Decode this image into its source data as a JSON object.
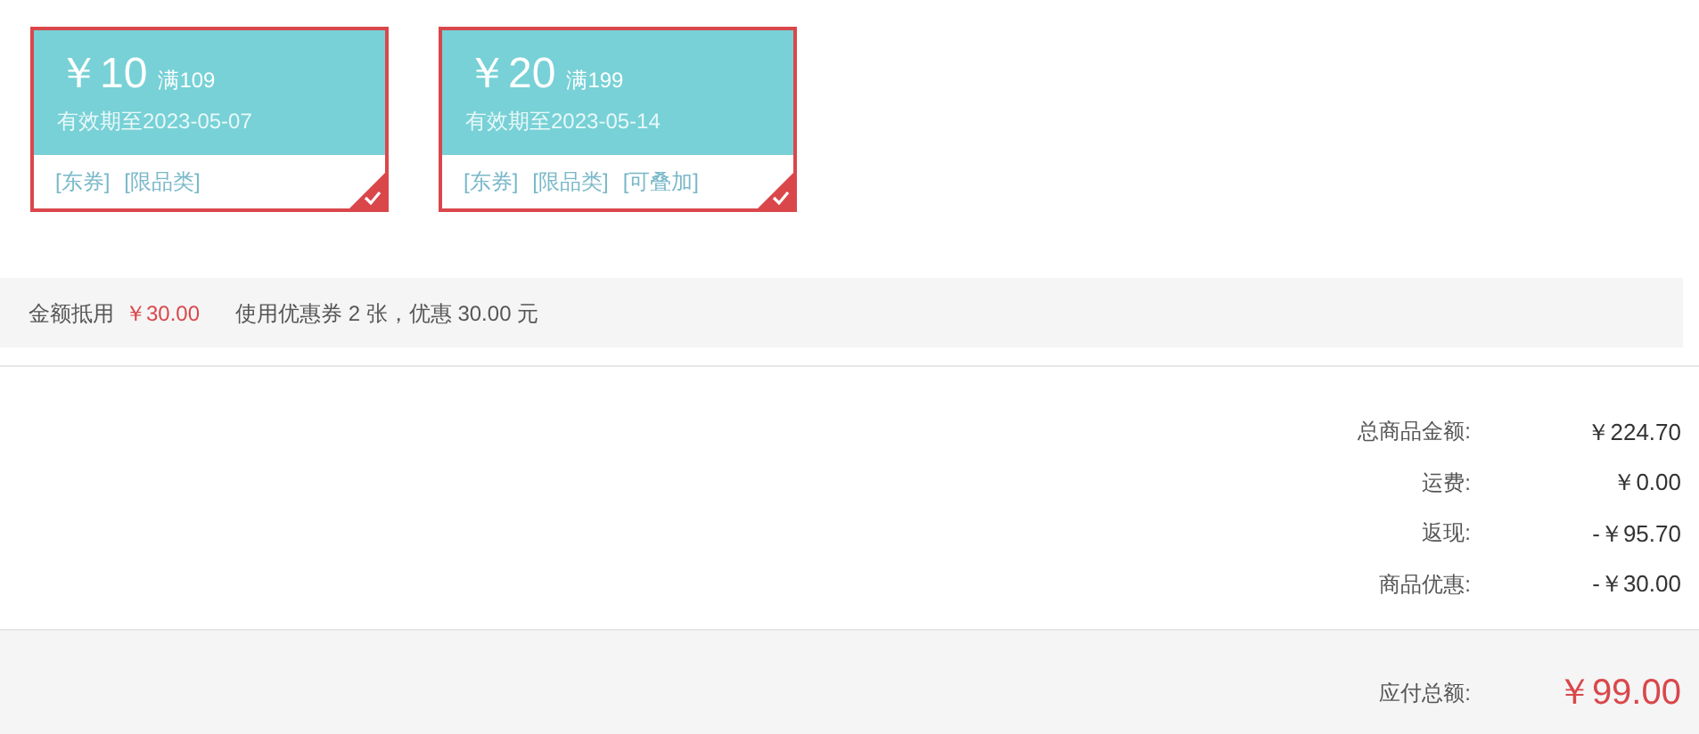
{
  "coupons": [
    {
      "currency": "￥",
      "amount": "10",
      "threshold": "满109",
      "validity": "有效期至2023-05-07",
      "tags": [
        "[东券]",
        "[限品类]"
      ],
      "selected": true
    },
    {
      "currency": "￥",
      "amount": "20",
      "threshold": "满199",
      "validity": "有效期至2023-05-14",
      "tags": [
        "[东券]",
        "[限品类]",
        "[可叠加]"
      ],
      "selected": true
    }
  ],
  "deduction": {
    "label": "金额抵用",
    "amount": "￥30.00",
    "note": "使用优惠券 2 张，优惠 30.00 元"
  },
  "summary": [
    {
      "label": "总商品金额:",
      "value": "￥224.70"
    },
    {
      "label": "运费:",
      "value": "￥0.00"
    },
    {
      "label": "返现:",
      "value": "-￥95.70"
    },
    {
      "label": "商品优惠:",
      "value": "-￥30.00"
    }
  ],
  "total": {
    "label": "应付总额:",
    "value": "￥99.00"
  }
}
